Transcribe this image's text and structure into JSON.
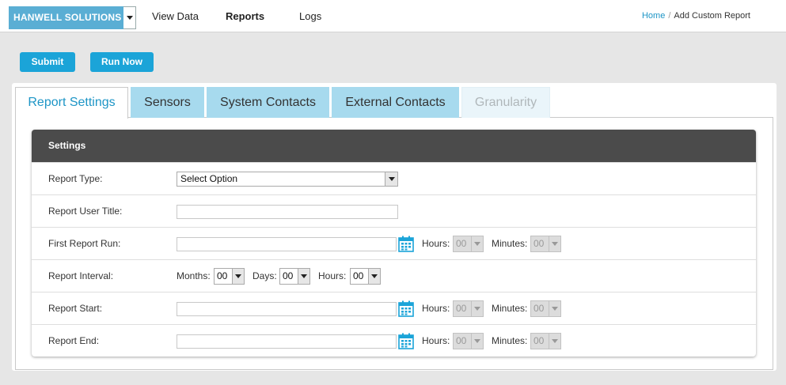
{
  "header": {
    "brand": "HANWELL SOLUTIONS",
    "nav": [
      {
        "label": "View Data"
      },
      {
        "label": "Reports"
      },
      {
        "label": "Logs"
      }
    ],
    "breadcrumb": {
      "home": "Home",
      "separator": "/",
      "current": "Add Custom Report"
    }
  },
  "toolbar": {
    "submit_label": "Submit",
    "run_now_label": "Run Now"
  },
  "tabs": [
    {
      "label": "Report Settings",
      "state": "active"
    },
    {
      "label": "Sensors",
      "state": "normal"
    },
    {
      "label": "System Contacts",
      "state": "normal"
    },
    {
      "label": "External Contacts",
      "state": "normal"
    },
    {
      "label": "Granularity",
      "state": "disabled"
    }
  ],
  "settings": {
    "title": "Settings",
    "report_type": {
      "label": "Report Type:",
      "value": "Select Option"
    },
    "report_user_title": {
      "label": "Report User Title:",
      "value": ""
    },
    "first_report_run": {
      "label": "First Report Run:",
      "hours_label": "Hours:",
      "hours": "00",
      "minutes_label": "Minutes:",
      "minutes": "00"
    },
    "report_interval": {
      "label": "Report Interval:",
      "months_label": "Months:",
      "months": "00",
      "days_label": "Days:",
      "days": "00",
      "hours_label": "Hours:",
      "hours": "00"
    },
    "report_start": {
      "label": "Report Start:",
      "hours_label": "Hours:",
      "hours": "00",
      "minutes_label": "Minutes:",
      "minutes": "00"
    },
    "report_end": {
      "label": "Report End:",
      "hours_label": "Hours:",
      "hours": "00",
      "minutes_label": "Minutes:",
      "minutes": "00"
    }
  },
  "colors": {
    "accent": "#1ba4d8",
    "brand": "#5aaed4",
    "tab_inactive": "#a7daee",
    "card_header": "#4b4b4b"
  },
  "icons": {
    "calendar": "calendar-icon",
    "dropdown": "chevron-down-icon"
  }
}
